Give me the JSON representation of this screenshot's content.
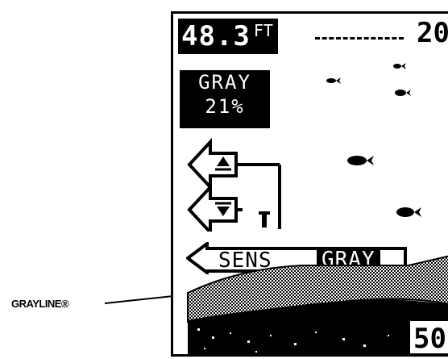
{
  "callout": {
    "label": "GRAYLINE®"
  },
  "display": {
    "depth_value": "48.3",
    "depth_unit": "FT",
    "scale_top": "20",
    "scale_bottom": "50",
    "grayline_label": "GRAY",
    "grayline_level": "21%",
    "sens_label": "SENS",
    "sens_mode": "GRAY"
  },
  "colors": {
    "foreground": "#000000",
    "background": "#ffffff"
  },
  "icons": [
    "fish-icon",
    "up-arrow-icon",
    "down-arrow-icon",
    "left-arrow-icon"
  ]
}
